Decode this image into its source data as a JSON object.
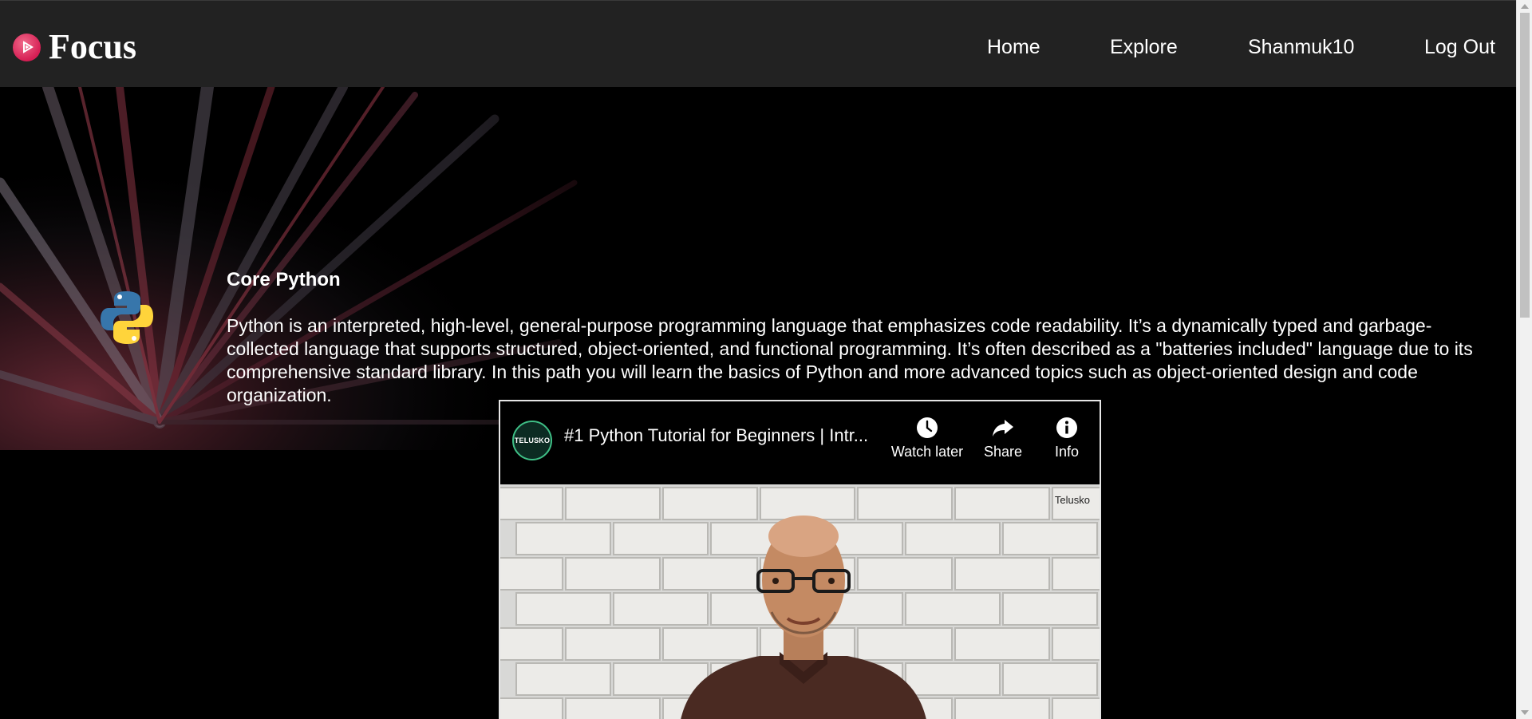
{
  "navbar": {
    "brand_name": "Focus",
    "brand_icon": "play-circle-icon",
    "links": {
      "home": "Home",
      "explore": "Explore",
      "user": "Shanmuk10",
      "logout": "Log Out"
    }
  },
  "course": {
    "icon": "python-logo-icon",
    "title": "Core Python",
    "description": "Python is an interpreted, high-level, general-purpose programming language that emphasizes code readability. It’s a dynamically typed and garbage-collected language that supports structured, object-oriented, and functional programming. It’s often described as a \"batteries included\" language due to its comprehensive standard library. In this path you will learn the basics of Python and more advanced topics such as object-oriented design and code organization."
  },
  "video": {
    "channel_logo_text": "TELUSKO",
    "title": "#1 Python Tutorial for Beginners | Intr...",
    "watermark": "Telusko",
    "actions": {
      "watch_later": "Watch later",
      "share": "Share",
      "info": "Info"
    }
  },
  "colors": {
    "navbar_bg": "#222222",
    "page_bg": "#000000",
    "brand_accent": "#e0245e",
    "text": "#ffffff"
  }
}
